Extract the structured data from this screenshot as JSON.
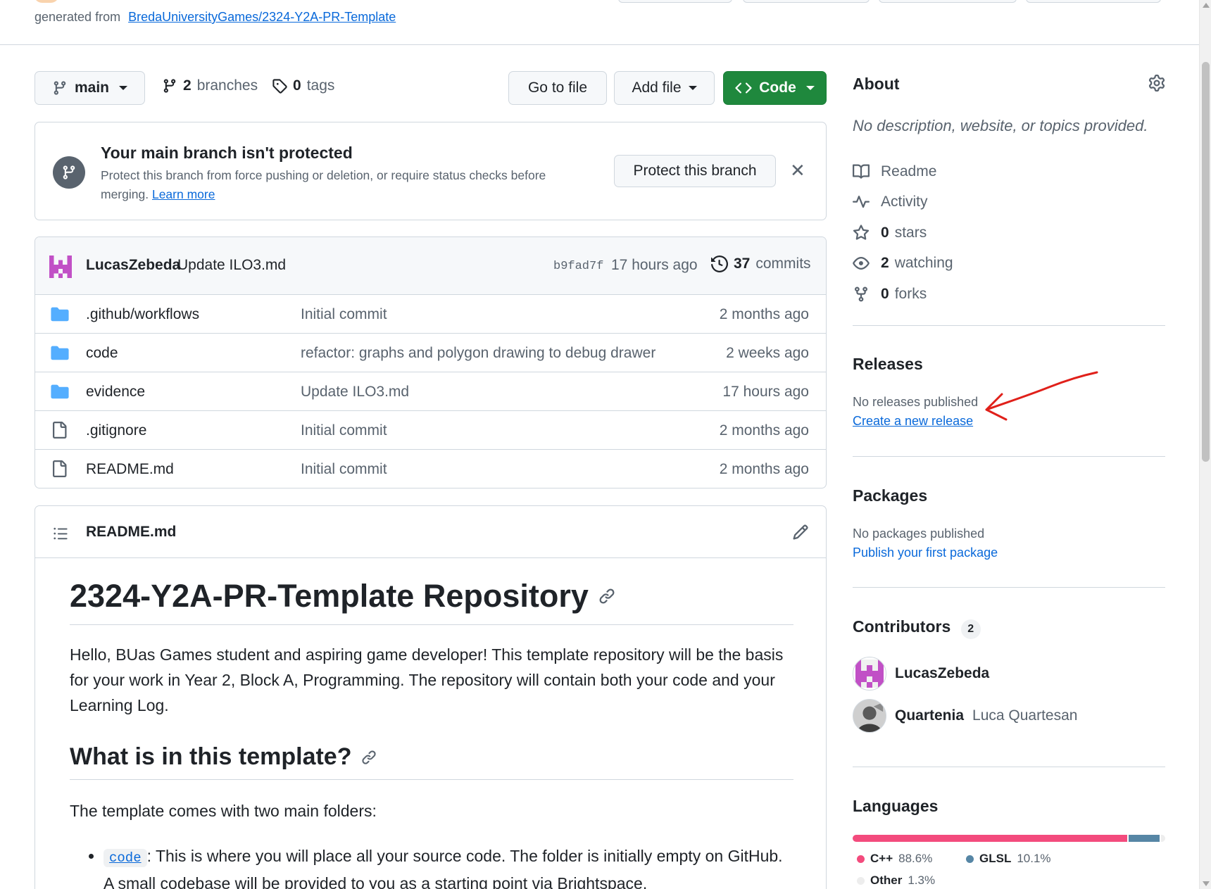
{
  "repo_header": {
    "generated_prefix": "generated from",
    "template_link": "BredaUniversityGames/2324-Y2A-PR-Template"
  },
  "branch_bar": {
    "branch_name": "main",
    "branches_count": "2",
    "branches_label": "branches",
    "tags_count": "0",
    "tags_label": "tags",
    "go_to_file": "Go to file",
    "add_file": "Add file",
    "code": "Code"
  },
  "protect_banner": {
    "title": "Your main branch isn't protected",
    "description": "Protect this branch from force pushing or deletion, or require status checks before merging.",
    "learn_more": "Learn more",
    "button": "Protect this branch"
  },
  "latest_commit": {
    "author": "LucasZebeda",
    "message": "Update ILO3.md",
    "hash": "b9fad7f",
    "time": "17 hours ago",
    "commits_count": "37",
    "commits_label": "commits"
  },
  "files": [
    {
      "name": ".github/workflows",
      "type": "folder",
      "commit": "Initial commit",
      "age": "2 months ago"
    },
    {
      "name": "code",
      "type": "folder",
      "commit": "refactor: graphs and polygon drawing to debug drawer",
      "age": "2 weeks ago"
    },
    {
      "name": "evidence",
      "type": "folder",
      "commit": "Update ILO3.md",
      "age": "17 hours ago"
    },
    {
      "name": ".gitignore",
      "type": "file",
      "commit": "Initial commit",
      "age": "2 months ago"
    },
    {
      "name": "README.md",
      "type": "file",
      "commit": "Initial commit",
      "age": "2 months ago"
    }
  ],
  "readme": {
    "filename": "README.md",
    "h1": "2324-Y2A-PR-Template Repository",
    "intro": "Hello, BUas Games student and aspiring game developer! This template repository will be the basis for your work in Year 2, Block A, Programming. The repository will contain both your code and your Learning Log.",
    "h2": "What is in this template?",
    "folders_intro": "The template comes with two main folders:",
    "bullet_code": "code",
    "bullet_text": ": This is where you will place all your source code. The folder is initially empty on GitHub. A small codebase will be provided to you as a starting point via Brightspace."
  },
  "sidebar": {
    "about_title": "About",
    "about_desc": "No description, website, or topics provided.",
    "about_items": [
      {
        "icon": "book-icon",
        "num": "",
        "label": "Readme"
      },
      {
        "icon": "pulse-icon",
        "num": "",
        "label": "Activity"
      },
      {
        "icon": "star-icon",
        "num": "0",
        "label": "stars"
      },
      {
        "icon": "eye-icon",
        "num": "2",
        "label": "watching"
      },
      {
        "icon": "fork-icon",
        "num": "0",
        "label": "forks"
      }
    ],
    "releases_title": "Releases",
    "releases_none": "No releases published",
    "releases_link": "Create a new release",
    "packages_title": "Packages",
    "packages_none": "No packages published",
    "packages_link": "Publish your first package",
    "contributors_title": "Contributors",
    "contributors_count": "2",
    "contributors": [
      {
        "login": "LucasZebeda",
        "name": ""
      },
      {
        "login": "Quartenia",
        "name": "Luca Quartesan"
      }
    ],
    "languages_title": "Languages",
    "languages": [
      {
        "name": "C++",
        "percent": "88.6%",
        "value": 88.6,
        "color": "#f34b7d"
      },
      {
        "name": "GLSL",
        "percent": "10.1%",
        "value": 10.1,
        "color": "#5686a5"
      },
      {
        "name": "Other",
        "percent": "1.3%",
        "value": 1.3,
        "color": "#ededed"
      }
    ]
  },
  "colors": {
    "accent_green": "#1f883d",
    "link_blue": "#0969da",
    "folder_blue": "#54aeff",
    "annotation_red": "#e0201a"
  }
}
